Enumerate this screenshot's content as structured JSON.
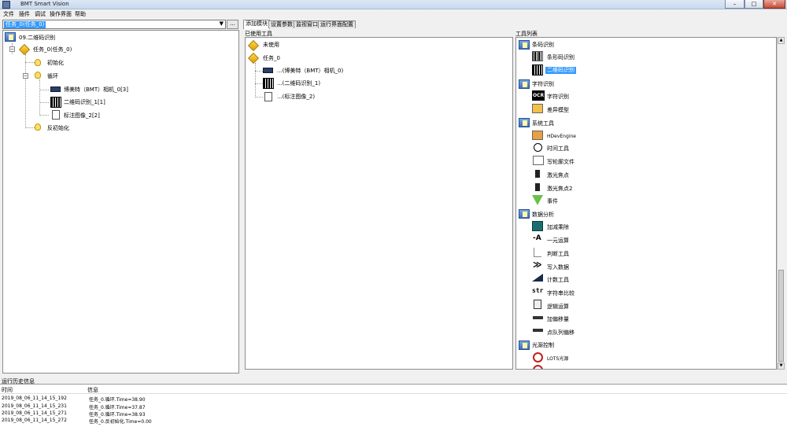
{
  "window": {
    "title": "BMT Smart Vision",
    "min": "–",
    "max": "□",
    "close": "✕"
  },
  "menu": [
    "文件",
    "插件",
    "调试",
    "操作界面",
    "帮助"
  ],
  "task_select": {
    "value": "任务_0(任务_0)",
    "more": "..."
  },
  "tree": {
    "root": "09.二维码识别",
    "task": "任务_0(任务_0)",
    "init": "初始化",
    "loop": "循环",
    "camera": "博美特（BMT）相机_0[3]",
    "qr": "二维码识别_1[1]",
    "mark": "标注图像_2[2]",
    "deinit": "反初始化"
  },
  "tabs": [
    "添加模块",
    "设置参数",
    "监视窗口",
    "运行界面配置"
  ],
  "used_tools": {
    "label": "已使用工具",
    "unused": "未使用",
    "task": "任务_0",
    "items": [
      "...(博美特（BMT）相机_0)",
      "...(二维码识别_1)",
      "...(标注图像_2)"
    ]
  },
  "tool_list": {
    "label": "工具列表",
    "barcode_group": "条码识别",
    "barcode": "条形码识别",
    "qrcode": "二维码识别",
    "char_group": "字符识别",
    "ocr_glyph": "OCR",
    "ocr": "字符识别",
    "diff": "差异模型",
    "sys_group": "系统工具",
    "hdev": "HDevEngine",
    "timer": "时间工具",
    "write": "写轮廓文件",
    "laser1": "激光焦点",
    "laser2": "激光焦点2",
    "event": "事件",
    "data_group": "数据分析",
    "arith": "加减乘除",
    "unary": "一元运算",
    "judge": "判断工具",
    "writedata": "写入数据",
    "count": "计数工具",
    "strcmp": "字符串比较",
    "logic": "逻辑运算",
    "offset": "加偏移量",
    "queue": "点队列偏移",
    "light_group": "光源控制",
    "lots": "LOTS光源"
  },
  "history": {
    "label": "运行历史信息",
    "headers": [
      "时间",
      "信息"
    ],
    "rows": [
      [
        "2019_08_06_11_14_15_192",
        "任务_0.循环.Time=38.90"
      ],
      [
        "2019_08_06_11_14_15_231",
        "任务_0.循环.Time=37.87"
      ],
      [
        "2019_08_06_11_14_15_271",
        "任务_0.循环.Time=38.93"
      ],
      [
        "2019_08_06_11_14_15_272",
        "任务_0.反初始化.Time=0.00"
      ]
    ]
  },
  "colors": {
    "selection": "#3399ff",
    "accent": "#3e6fbf"
  }
}
